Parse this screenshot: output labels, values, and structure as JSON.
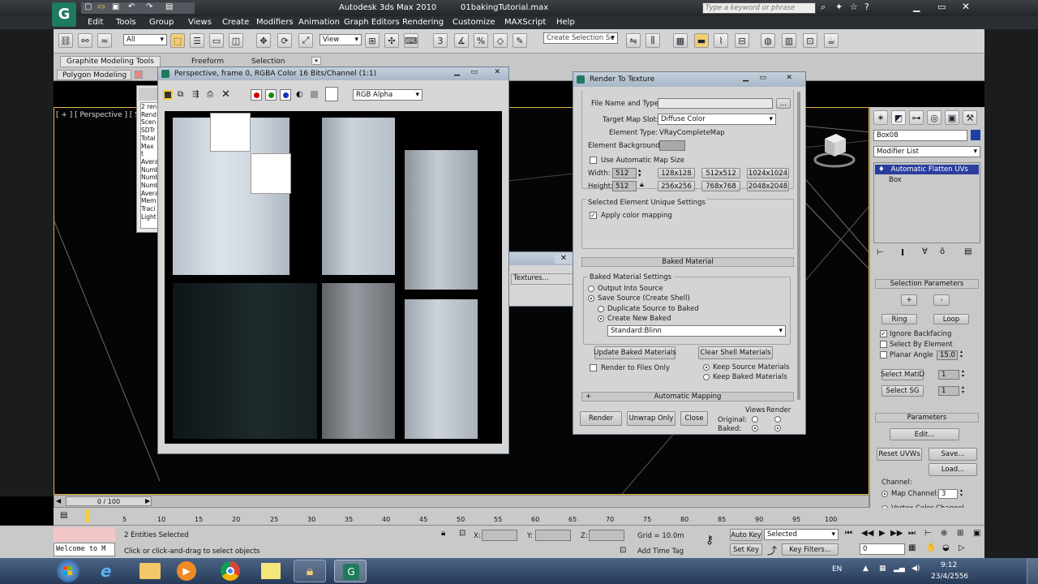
{
  "app": {
    "title": "Autodesk 3ds Max 2010",
    "file": "01bakingTutorial.max",
    "search_placeholder": "Type a keyword or phrase",
    "menu": [
      "Edit",
      "Tools",
      "Group",
      "Views",
      "Create",
      "Modifiers",
      "Animation",
      "Graph Editors",
      "Rendering",
      "Customize",
      "MAXScript",
      "Help"
    ]
  },
  "toolbar": {
    "selection_filter": "All",
    "ref_coord": "View",
    "snap_label": "3",
    "selection_set_placeholder": "Create Selection Se"
  },
  "ribbon": {
    "tabs": [
      "Graphite Modeling Tools",
      "Freeform",
      "Selection"
    ],
    "sub": "Polygon Modeling"
  },
  "viewport": {
    "label": "[ + ] [ Perspective ] [ Smo",
    "info_lines": [
      "2 ren",
      "Rend",
      "Scen",
      "SDTr",
      "Total",
      "Max t",
      "Avera",
      "Numb",
      "Numb",
      "Numb",
      "Avera",
      "Mem",
      "Traci",
      "Light"
    ]
  },
  "frame_window": {
    "title": "Perspective, frame 0, RGBA Color 16 Bits/Channel (1:1)",
    "channel_dropdown": "RGB Alpha"
  },
  "small_dialog": {
    "item": "Textures..."
  },
  "rtt": {
    "title": "Render To Texture",
    "file_name_label": "File Name and Type:",
    "target_map_label": "Target Map Slot:",
    "target_map_value": "Diffuse Color",
    "element_type_label": "Element Type:",
    "element_type_value": "VRayCompleteMap",
    "element_bg_label": "Element Background:",
    "auto_map_size": "Use Automatic Map Size",
    "width_label": "Width:",
    "width_value": "512",
    "height_label": "Height:",
    "height_value": "512",
    "size_buttons": [
      "128x128",
      "512x512",
      "1024x1024",
      "256x256",
      "768x768",
      "2048x2048"
    ],
    "unique_settings_label": "Selected Element Unique Settings",
    "apply_color_mapping": "Apply color mapping",
    "baked_material_header": "Baked Material",
    "baked_material_settings": "Baked Material Settings",
    "output_into_source": "Output Into Source",
    "save_source": "Save Source (Create Shell)",
    "duplicate_source": "Duplicate Source to Baked",
    "create_new_baked": "Create New Baked",
    "material_type": "Standard:Blinn",
    "update_baked": "Update Baked Materials",
    "clear_shell": "Clear Shell Materials",
    "render_to_files": "Render to Files Only",
    "keep_source": "Keep Source Materials",
    "keep_baked": "Keep Baked Materials",
    "auto_mapping_header": "Automatic Mapping",
    "render_button": "Render",
    "unwrap_button": "Unwrap Only",
    "close_button": "Close",
    "views_label": "Views",
    "render_label": "Render",
    "original_label": "Original:",
    "baked_label": "Baked:"
  },
  "command_panel": {
    "object_name": "Box08",
    "modifier_list": "Modifier List",
    "stack": [
      "Automatic Flatten UVs",
      "Box"
    ],
    "selection_parameters": "Selection Parameters",
    "ring": "Ring",
    "loop": "Loop",
    "ignore_backfacing": "Ignore Backfacing",
    "select_by_element": "Select By Element",
    "planar_angle": "Planar Angle",
    "planar_angle_value": "15.0",
    "select_matid": "Select MatID",
    "matid_value": "1",
    "select_sg": "Select SG",
    "sg_value": "1",
    "parameters": "Parameters",
    "edit": "Edit...",
    "reset_uvws": "Reset UVWs",
    "save": "Save...",
    "load": "Load...",
    "channel_label": "Channel:",
    "map_channel": "Map Channel:",
    "map_channel_value": "3",
    "vertex_color_channel": "Vertex Color Channel"
  },
  "timeline": {
    "frame_counter": "0 / 100",
    "ticks": [
      "5",
      "10",
      "15",
      "20",
      "25",
      "30",
      "35",
      "40",
      "45",
      "50",
      "55",
      "60",
      "65",
      "70",
      "75",
      "80",
      "85",
      "90",
      "95",
      "100"
    ]
  },
  "status": {
    "maxscript": "Welcome to M",
    "entities": "2 Entities Selected",
    "prompt": "Click or click-and-drag to select objects",
    "x_label": "X:",
    "y_label": "Y:",
    "z_label": "Z:",
    "grid": "Grid = 10.0m",
    "add_time_tag": "Add Time Tag",
    "auto_key": "Auto Key",
    "selected": "Selected",
    "set_key": "Set Key",
    "key_filters": "Key Filters...",
    "frame": "0"
  },
  "taskbar": {
    "lang": "EN",
    "time": "9:12",
    "date": "23/4/2556"
  },
  "colors": {
    "titlebar": "#2a2d31",
    "accent_blue": "#1f3ea8",
    "ui_gray": "#c8c8c8"
  }
}
